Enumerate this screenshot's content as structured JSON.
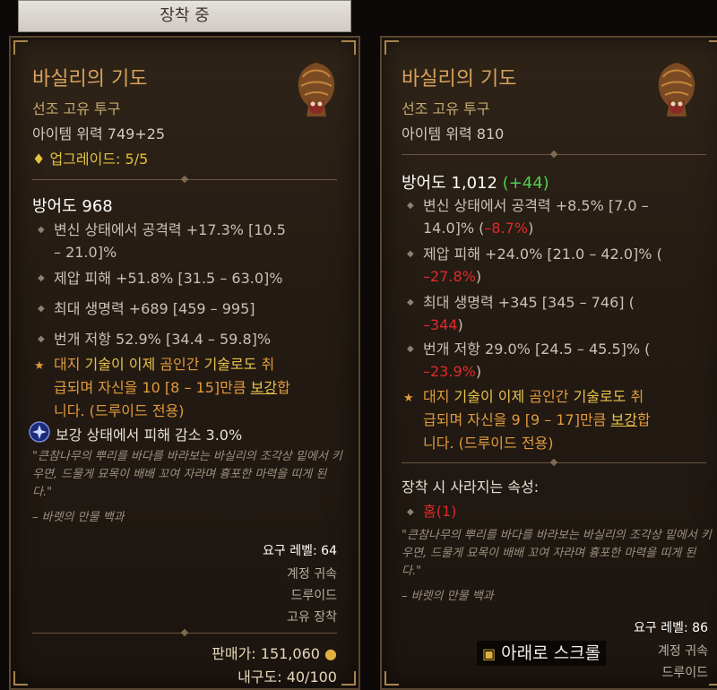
{
  "equipped_tab": "장착 중",
  "left": {
    "name": "바실리의 기도",
    "type": "선조 고유 투구",
    "item_power": "아이템 위력 749+25",
    "upgrade": "업그레이드: 5/5",
    "armor": "방어도 968",
    "stats": [
      {
        "l1": "변신 상태에서 공격력 +17.3% [10.5",
        "l2": "– 21.0]%"
      },
      {
        "l1": "제압 피해 +51.8% [31.5 – 63.0]%"
      },
      {
        "l1": "최대 생명력 +689 [459 – 995]"
      },
      {
        "l1": "번개 저항 52.9% [34.4 – 59.8]%"
      }
    ],
    "legendary": {
      "p1": "대지 ",
      "p2": "기술이 이제",
      "p3": " 곰인간 ",
      "p4": "기술로도",
      "p5": " 취",
      "p6": "급되며 자신을 10 [8 – 15]만큼 ",
      "p7": "보강",
      "p8": "합",
      "p9": "니다. (드루이드 전용)"
    },
    "aspect": "보강 상태에서 피해 감소 3.0%",
    "flavor": "\"큰참나무의 뿌리를 바다를 바라보는 바실리의 조각상 밑에서 키우면, 드물게 묘목이 배배 꼬여 자라며 흉포한 마력을 띠게 된다.\"",
    "flavor_source": "– 바렛의 만물 백과",
    "required_level": "요구 레벨: 64",
    "account_bound": "계정 귀속",
    "class": "드루이드",
    "unique_equip": "고유 장착",
    "sell_price": "판매가: 151,060",
    "durability": "내구도: 40/100"
  },
  "right": {
    "name": "바실리의 기도",
    "type": "선조 고유 투구",
    "item_power": "아이템 위력 810",
    "armor": "방어도 1,012",
    "armor_diff": "(+44)",
    "stats": [
      {
        "l1": "변신 상태에서 공격력 +8.5% [7.0 –",
        "l2a": "14.0]% (",
        "l2b": "–8.7%",
        "l2c": ")"
      },
      {
        "l1": "제압 피해 +24.0% [21.0 – 42.0]% (",
        "l2b": "–27.8%",
        "l2c": ")"
      },
      {
        "l1": "최대 생명력 +345 [345 – 746] (",
        "l2b": "–344",
        "l2c": ")"
      },
      {
        "l1": "번개 저항 29.0% [24.5 – 45.5]% (",
        "l2b": "–23.9%",
        "l2c": ")"
      }
    ],
    "legendary": {
      "p1": "대지 ",
      "p2": "기술이 이제",
      "p3": " 곰인간 ",
      "p4": "기술로도",
      "p5": " 취",
      "p6": "급되며 자신을 9 [9 – 17]만큼 ",
      "p7": "보강",
      "p8": "합",
      "p9": "니다. (드루이드 전용)"
    },
    "lost_header": "장착 시 사라지는 속성:",
    "lost_item": "홈(1)",
    "flavor": "\"큰참나무의 뿌리를 바다를 바라보는 바실리의 조각상 밑에서 키우면, 드물게 묘목이 배배 꼬여 자라며 흉포한 마력을 띠게 된다.\"",
    "flavor_source": "– 바렛의 만물 백과",
    "required_level": "요구 레벨: 86",
    "account_bound": "계정 귀속",
    "class": "드루이드"
  },
  "scroll_hint": "아래로 스크롤",
  "colors": {
    "legendary": "#e09a3c",
    "negative": "#e02a2a",
    "positive": "#4fd04f",
    "title": "#d7a15a"
  }
}
